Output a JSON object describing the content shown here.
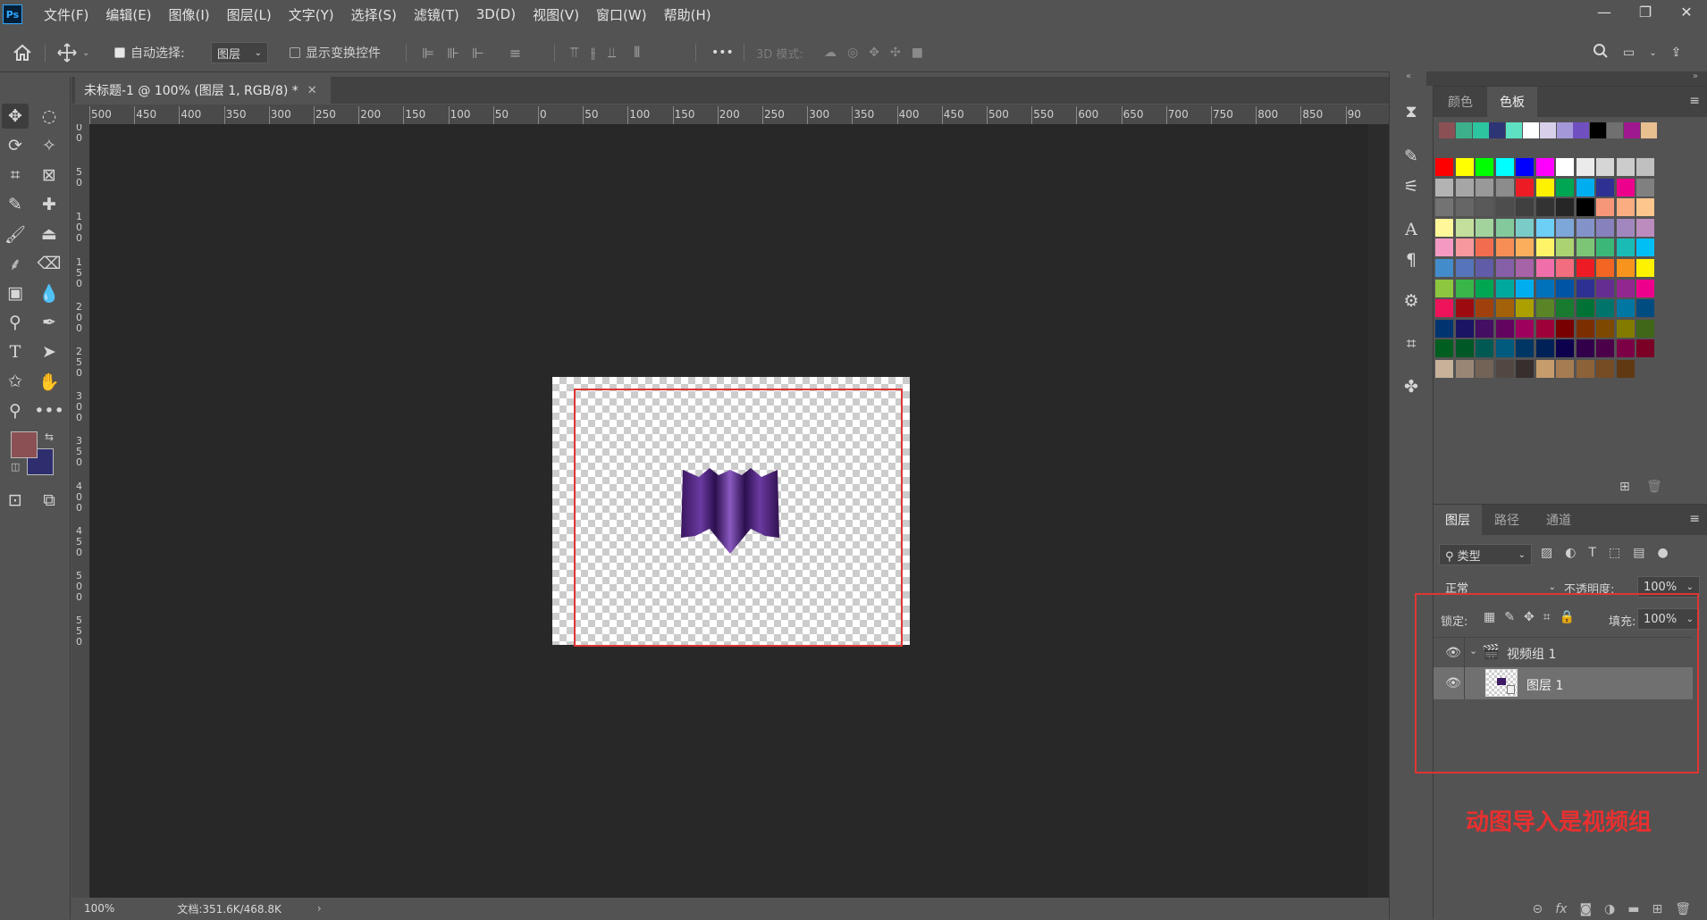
{
  "app": {
    "logo": "Ps"
  },
  "menu": [
    "文件(F)",
    "编辑(E)",
    "图像(I)",
    "图层(L)",
    "文字(Y)",
    "选择(S)",
    "滤镜(T)",
    "3D(D)",
    "视图(V)",
    "窗口(W)",
    "帮助(H)"
  ],
  "window_controls": {
    "minimize": "—",
    "restore": "❐",
    "close": "✕"
  },
  "options_bar": {
    "auto_select_label": "自动选择:",
    "auto_select_checked": true,
    "auto_select_target": "图层",
    "show_transform_label": "显示变换控件",
    "show_transform_checked": false,
    "mode_3d_label": "3D 模式:",
    "more": "•••"
  },
  "document": {
    "tab_title": "未标题-1 @ 100% (图层 1, RGB/8) *",
    "zoom": "100%",
    "doc_size": "文档:351.6K/468.8K"
  },
  "ruler_h": [
    "500",
    "450",
    "400",
    "350",
    "300",
    "250",
    "200",
    "150",
    "100",
    "50",
    "0",
    "50",
    "100",
    "150",
    "200",
    "250",
    "300",
    "350",
    "400",
    "450",
    "500",
    "550",
    "600",
    "650",
    "700",
    "750",
    "800",
    "850",
    "90"
  ],
  "ruler_v": [
    [
      "0",
      "0"
    ],
    [
      "5",
      "0"
    ],
    [
      "1",
      "0",
      "0"
    ],
    [
      "1",
      "5",
      "0"
    ],
    [
      "2",
      "0",
      "0"
    ],
    [
      "2",
      "5",
      "0"
    ],
    [
      "3",
      "0",
      "0"
    ],
    [
      "3",
      "5",
      "0"
    ],
    [
      "4",
      "0",
      "0"
    ],
    [
      "4",
      "5",
      "0"
    ],
    [
      "5",
      "0",
      "0"
    ],
    [
      "5",
      "5",
      "0"
    ]
  ],
  "colors": {
    "foreground": "#8a5053",
    "background": "#2e2e6e"
  },
  "swatch_panel": {
    "tabs": [
      "颜色",
      "色板"
    ],
    "active_tab": "色板",
    "recent": [
      "#8a5053",
      "#3cb08a",
      "#2dc4a0",
      "#2e3575",
      "#5ee0c2",
      "#ffffff",
      "#d8d0ea",
      "#a598d8",
      "#7050c0",
      "#000000",
      "#707070",
      "#a01890",
      "#e8c090"
    ],
    "rows": [
      [
        "#ff0000",
        "#ffff00",
        "#00ff00",
        "#00ffff",
        "#0000ff",
        "#ff00ff",
        "#ffffff",
        "#ebebeb",
        "#d6d6d6",
        "#cccccc",
        "#c0c0c0"
      ],
      [
        "#b3b3b3",
        "#a6a6a6",
        "#999999",
        "#8c8c8c",
        "#ed1c24",
        "#fff200",
        "#00a651",
        "#00aeef",
        "#2e3192",
        "#ec008c",
        "#808080"
      ],
      [
        "#737373",
        "#666666",
        "#595959",
        "#4d4d4d",
        "#404040",
        "#333333",
        "#262626",
        "#000000",
        "#f7977a",
        "#fbad82",
        "#fdc68c"
      ],
      [
        "#fff799",
        "#c4df9b",
        "#a3d39c",
        "#82ca9c",
        "#7accc8",
        "#6dcff6",
        "#7da7d9",
        "#8393ca",
        "#8781bd",
        "#a187be",
        "#bc8cbf"
      ],
      [
        "#f49ac2",
        "#f6989d",
        "#f26c4f",
        "#f68e55",
        "#fbaf5c",
        "#fff467",
        "#acd372",
        "#7cc576",
        "#3bb878",
        "#1abbb4",
        "#00bff3"
      ],
      [
        "#438ccb",
        "#5574b9",
        "#605ca8",
        "#8560a8",
        "#a763a8",
        "#f06eaa",
        "#f26d7d",
        "#ed1c24",
        "#f26522",
        "#f7941d",
        "#fff200"
      ],
      [
        "#8dc63f",
        "#39b54a",
        "#00a651",
        "#00a99d",
        "#00aeef",
        "#0072bc",
        "#0054a6",
        "#2e3192",
        "#662d91",
        "#92278f",
        "#ec008c"
      ],
      [
        "#ed145b",
        "#9e0b0f",
        "#a0410d",
        "#a36209",
        "#aba000",
        "#598527",
        "#197b30",
        "#007236",
        "#00746b",
        "#0076a3",
        "#004b80"
      ],
      [
        "#003471",
        "#1b1464",
        "#440e62",
        "#630460",
        "#9e005d",
        "#9e0039",
        "#790000",
        "#7b2e00",
        "#7d4900",
        "#827b00",
        "#406618"
      ],
      [
        "#005e20",
        "#005826",
        "#005952",
        "#005b7f",
        "#003663",
        "#002157",
        "#0d004c",
        "#32004b",
        "#4b0049",
        "#7b0046",
        "#7a0026"
      ],
      [
        "#c7b299",
        "#998675",
        "#736357",
        "#534741",
        "#362f2d",
        "#c69c6d",
        "#a67c52",
        "#8c6239",
        "#754c24",
        "#603913"
      ]
    ]
  },
  "layers_panel": {
    "tabs": [
      "图层",
      "路径",
      "通道"
    ],
    "active_tab": "图层",
    "filter_label": "类型",
    "blend_mode": "正常",
    "opacity_label": "不透明度:",
    "opacity_value": "100%",
    "lock_label": "锁定:",
    "fill_label": "填充:",
    "fill_value": "100%",
    "layers": [
      {
        "name": "视频组 1",
        "type": "video-group",
        "visible": true,
        "selected": false
      },
      {
        "name": "图层 1",
        "type": "layer",
        "visible": true,
        "selected": true
      }
    ],
    "footer_icons": [
      "link-icon",
      "fx-icon",
      "mask-icon",
      "adjustment-icon",
      "folder-icon",
      "new-layer-icon",
      "trash-icon"
    ],
    "fx_label": "fx"
  },
  "annotation": {
    "text": "动图导入是视频组",
    "color": "#e83030"
  }
}
